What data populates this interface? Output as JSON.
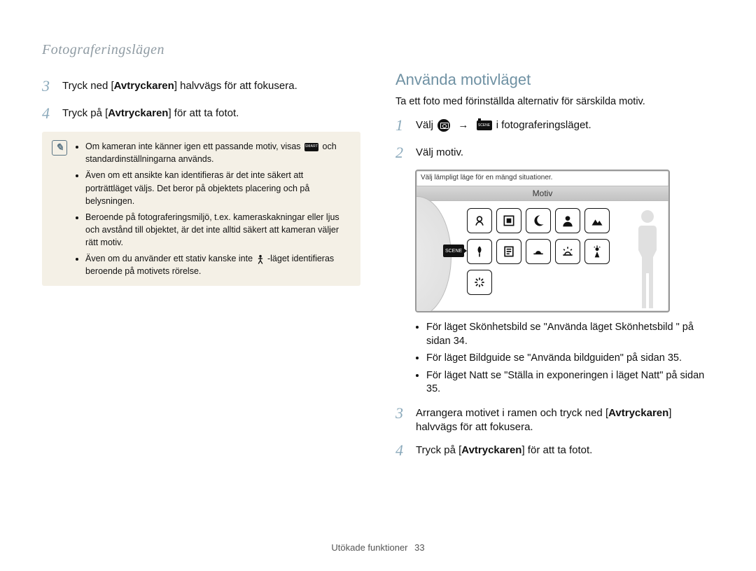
{
  "breadcrumb": "Fotograferingslägen",
  "left": {
    "step3": {
      "num": "3",
      "pre": "Tryck ned [",
      "bold": "Avtryckaren",
      "post": "] halvvägs för att fokusera."
    },
    "step4": {
      "num": "4",
      "pre": "Tryck på [",
      "bold": "Avtryckaren",
      "post": "] för att ta fotot."
    },
    "notes": {
      "n1a": "Om kameran inte känner igen ett passande motiv, visas ",
      "n1b": " och standardinställningarna används.",
      "n2": "Även om ett ansikte kan identifieras är det inte säkert att porträttläget väljs. Det beror på objektets placering och på belysningen.",
      "n3": "Beroende på fotograferingsmiljö, t.ex. kameraskakningar eller ljus och avstånd till objektet, är det inte alltid säkert att kameran väljer rätt motiv.",
      "n4a": "Även om du använder ett stativ kanske inte ",
      "n4b": "-läget identifieras beroende på motivets rörelse."
    }
  },
  "right": {
    "heading": "Använda motivläget",
    "lead": "Ta ett foto med förinställda alternativ för särskilda motiv.",
    "step1": {
      "num": "1",
      "pre": "Välj ",
      "post": " i fotograferingsläget."
    },
    "step2": {
      "num": "2",
      "text": "Välj motiv."
    },
    "screen": {
      "hint": "Välj lämpligt läge för en mängd situationer.",
      "title": "Motiv",
      "chip": "SCENE"
    },
    "bullets": {
      "b1": "För läget Skönhetsbild se \"Använda läget Skönhetsbild \" på sidan 34.",
      "b2": "För läget Bildguide se \"Använda bildguiden\" på sidan 35.",
      "b3": "För läget Natt se \"Ställa in exponeringen i läget Natt\" på sidan 35."
    },
    "step3": {
      "num": "3",
      "pre": "Arrangera motivet i ramen och tryck ned [",
      "bold": "Avtryckaren",
      "post": "] halvvägs för att fokusera."
    },
    "step4": {
      "num": "4",
      "pre": "Tryck på [",
      "bold": "Avtryckaren",
      "post": "] för att ta fotot."
    }
  },
  "footer": {
    "label": "Utökade funktioner",
    "page": "33"
  }
}
